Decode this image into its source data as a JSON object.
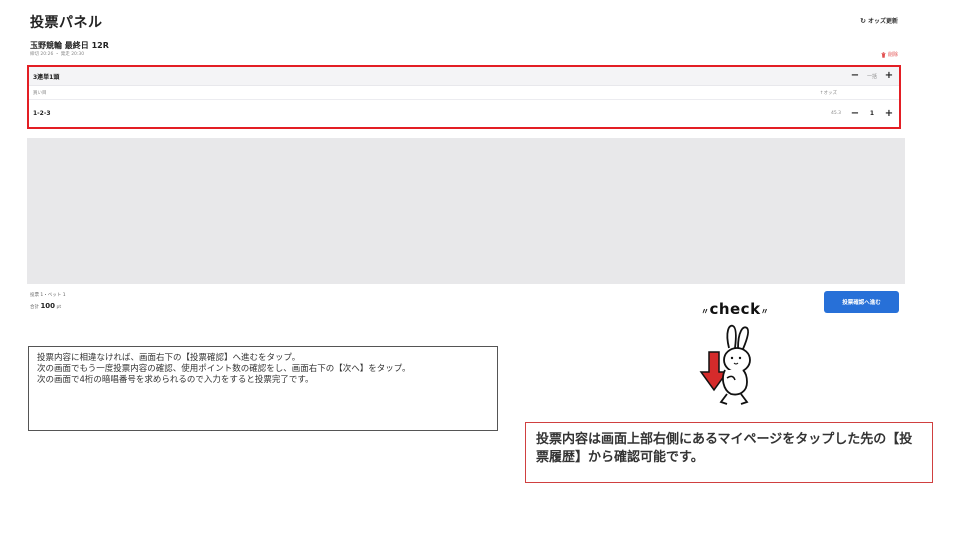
{
  "header": {
    "title": "投票パネル",
    "refresh_label": "オッズ更新"
  },
  "race": {
    "name": "玉野競輪 最終日 12R",
    "times": "締切 20:26 ・ 発走 20:30",
    "delete_label": "削除"
  },
  "bet": {
    "type": "3連単1頭",
    "type_stepper": {
      "minus": "−",
      "value": "一括",
      "plus": "+"
    },
    "sub_left": "買い目",
    "sub_right": "↑オッズ",
    "rows": [
      {
        "combo": "1-2-3",
        "odds": "45.3",
        "minus": "−",
        "count": "1",
        "plus": "+"
      }
    ]
  },
  "summary": {
    "count": "投票 1・ベット 1",
    "total_label": "合計",
    "total_amount": "100",
    "total_unit": "pt"
  },
  "confirm_button": "投票確認へ進む",
  "check_label": "check",
  "note": {
    "lines": [
      "投票内容に相違なければ、画面右下の【投票確認】へ進むをタップ。",
      "次の画面でもう一度投票内容の確認、使用ポイント数の確認をし、画面右下の【次へ】をタップ。",
      "次の画面で4桁の暗唱番号を求められるので入力をすると投票完了です。"
    ]
  },
  "info": {
    "text": "投票内容は画面上部右側にあるマイページをタップした先の【投票履歴】から確認可能です。"
  },
  "colors": {
    "accent_red": "#e31e24",
    "button_blue": "#2770d8",
    "panel_gray": "#e8e8ea",
    "arrow_red": "#d52b2b"
  }
}
